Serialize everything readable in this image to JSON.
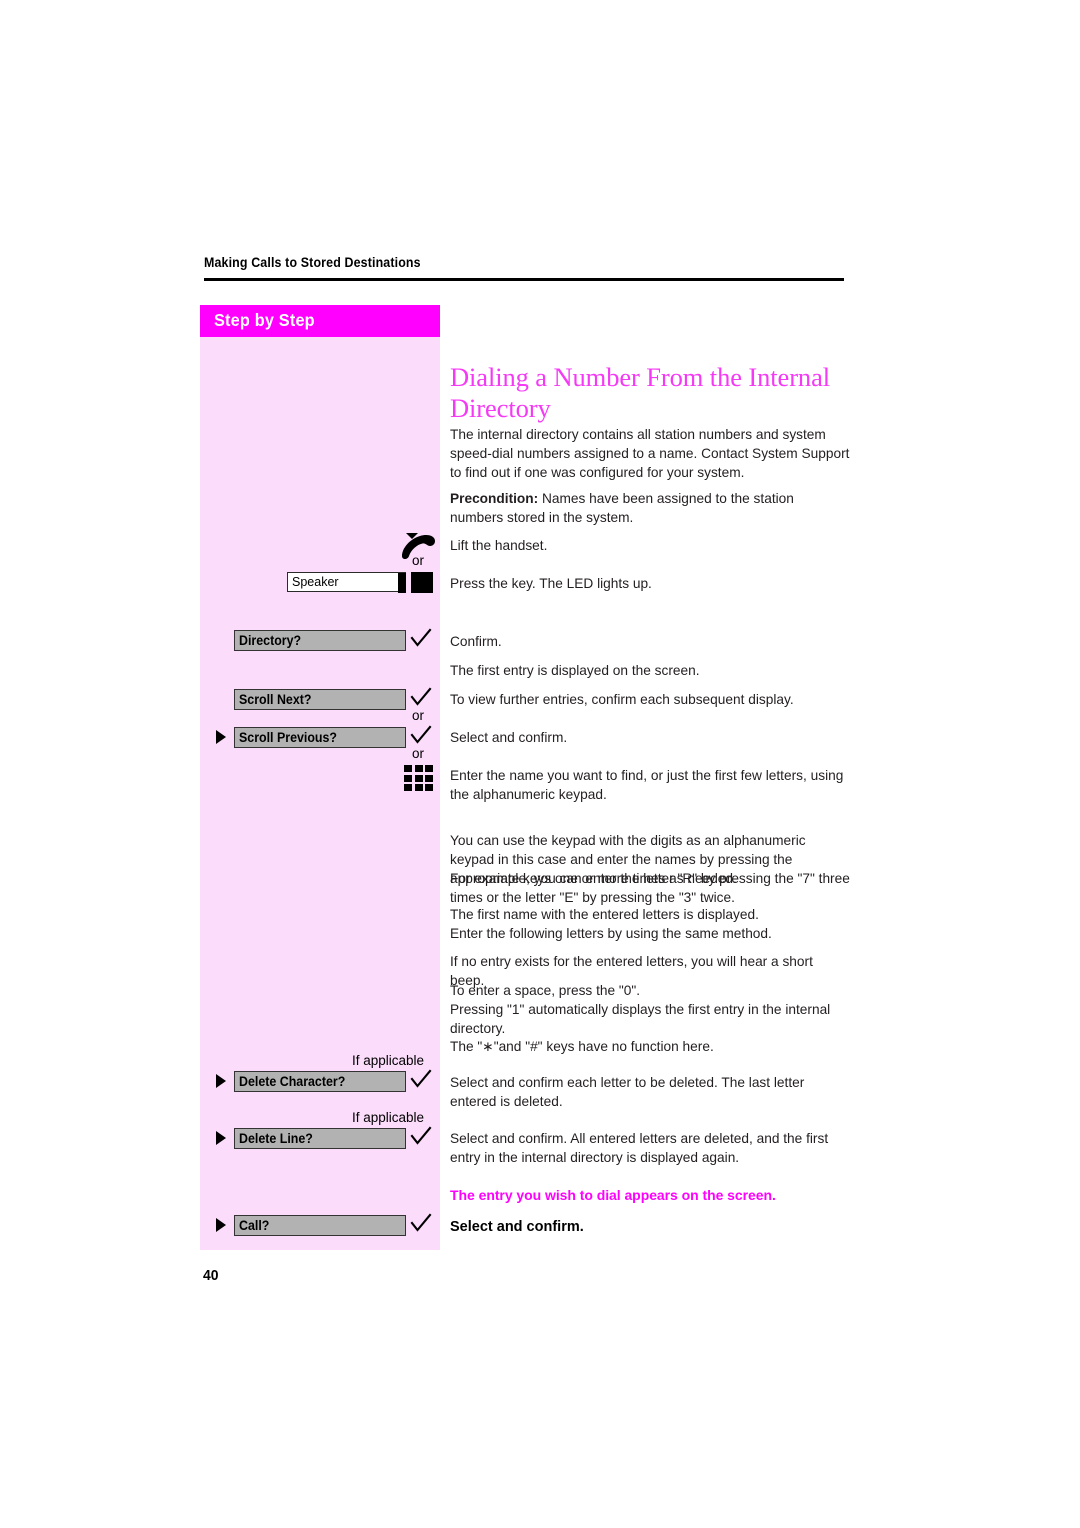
{
  "page": {
    "running_head": "Making Calls to Stored Destinations",
    "folio": "40",
    "colors": {
      "accent_magenta": "#FF00FF",
      "title_magenta": "#F53AF5",
      "sidebar_pink": "#FBDCFB",
      "option_gray": "#B2B2B2",
      "body_text": "#231F20"
    }
  },
  "sidebar": {
    "banner_label": "Step by Step",
    "or_label": "or",
    "if_applicable_label": "If applicable",
    "items": [
      {
        "kind": "handset-icon",
        "icon": "lifted-handset-icon"
      },
      {
        "kind": "key",
        "label": "Speaker",
        "icon": "led-indicator"
      },
      {
        "kind": "option",
        "label": "Directory?",
        "arrow": false,
        "check": true
      },
      {
        "kind": "option",
        "label": "Scroll Next?",
        "arrow": false,
        "check": true
      },
      {
        "kind": "option",
        "label": "Scroll Previous?",
        "arrow": true,
        "check": true
      },
      {
        "kind": "keypad-icon",
        "icon": "alphanumeric-keypad-icon"
      },
      {
        "kind": "option",
        "label": "Delete Character?",
        "arrow": true,
        "check": true,
        "note": "If applicable"
      },
      {
        "kind": "option",
        "label": "Delete Line?",
        "arrow": true,
        "check": true,
        "note": "If applicable"
      },
      {
        "kind": "option",
        "label": "Call?",
        "arrow": true,
        "check": true
      }
    ]
  },
  "main": {
    "title": "Dialing a Number From the Internal Directory",
    "blocks": {
      "intro": "The internal directory contains all station numbers and system speed-dial numbers assigned to a name. Contact System Support to find out if one was configured for your system.",
      "precondition_label": "Precondition:",
      "precondition_text": " Names have been assigned to the station numbers stored in the system.",
      "lift_handset": "Lift the handset.",
      "press_key": "Press the key. The LED lights up.",
      "confirm": "Confirm.",
      "first_entry": "The first entry is displayed on the screen.",
      "view_further": "To view further entries, confirm each subsequent display.",
      "select_confirm": "Select and confirm.",
      "enter_name": "Enter the name you want to find, or just the first few letters, using the alphanumeric keypad.",
      "keypad_usage": "You can use the keypad with the digits as an alphanumeric keypad in this case and enter the names by pressing the appropriate keys one or more times as needed.",
      "keypad_example": "For example, you can enter the letter \"R\" by pressing the \"7\" three times or the letter \"E\" by pressing the \"3\" twice.",
      "first_name_shown": "The first name with the entered letters is displayed.",
      "following_letters": "Enter the following letters by using the same method.",
      "no_entry_beep": "If no entry exists for the entered letters, you will hear a short beep.",
      "space_key": "To enter a space, press the \"0\".",
      "one_key": "Pressing \"1\" automatically displays the first entry in the internal directory.",
      "star_hash_keys": "The \"∗\"and \"#\" keys have no function here.",
      "delete_character_text": "Select and confirm each letter to be deleted. The last letter entered is deleted.",
      "delete_line_text": "Select and confirm. All entered letters are deleted, and the first entry in the internal directory is displayed again.",
      "entry_appears": "The entry you wish to dial appears on the screen.",
      "select_confirm_bold": "Select and confirm."
    }
  }
}
